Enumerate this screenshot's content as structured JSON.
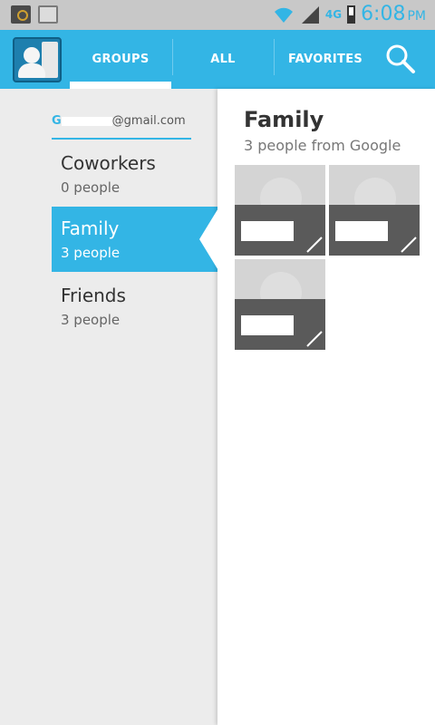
{
  "status_bar": {
    "network_type": "4G",
    "time": "6:08",
    "ampm": "PM"
  },
  "action_bar": {
    "tabs": [
      {
        "label": "GROUPS",
        "selected": true
      },
      {
        "label": "ALL",
        "selected": false
      },
      {
        "label": "FAVORITES",
        "selected": false
      }
    ],
    "search_icon": "search-icon",
    "accent_color": "#33b5e5"
  },
  "groups_list": {
    "account_prefix": "G",
    "account_suffix": "@gmail.com",
    "items": [
      {
        "name": "Coworkers",
        "count": "0 people",
        "selected": false
      },
      {
        "name": "Family",
        "count": "3 people",
        "selected": true
      },
      {
        "name": "Friends",
        "count": "3 people",
        "selected": false
      }
    ]
  },
  "group_detail": {
    "title": "Family",
    "subtitle": "3 people from Google",
    "member_count": 3
  }
}
